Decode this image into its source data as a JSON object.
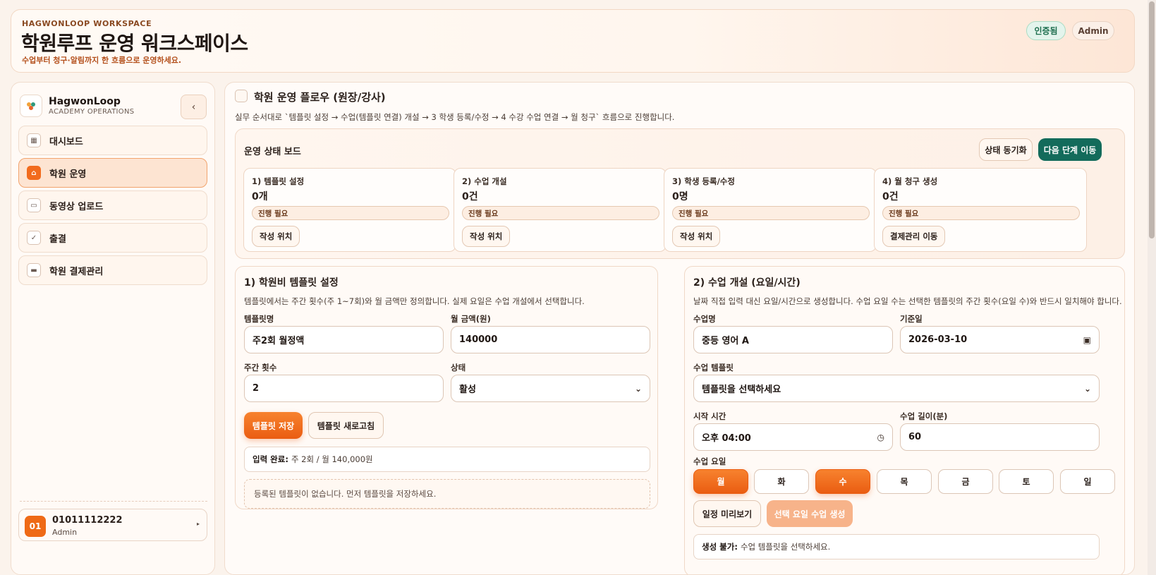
{
  "header": {
    "eyebrow": "HAGWONLOOP WORKSPACE",
    "title": "학원루프 운영 워크스페이스",
    "subtitle": "수업부터 청구·알림까지 한 흐름으로 운영하세요.",
    "verified_label": "인증됨",
    "role_label": "Admin"
  },
  "sidebar": {
    "brand_name": "HagwonLoop",
    "brand_sub": "ACADEMY OPERATIONS",
    "collapse_icon": "‹",
    "items": [
      {
        "label": "대시보드",
        "icon": "dashboard-icon",
        "active": false
      },
      {
        "label": "학원 운영",
        "icon": "building-icon",
        "active": true
      },
      {
        "label": "동영상 업로드",
        "icon": "video-icon",
        "active": false
      },
      {
        "label": "출결",
        "icon": "calendar-check-icon",
        "active": false
      },
      {
        "label": "학원 결제관리",
        "icon": "card-icon",
        "active": false
      }
    ],
    "user": {
      "badge": "01",
      "phone": "01011112222",
      "role": "Admin",
      "caret": "▸"
    }
  },
  "flow": {
    "title": "학원 운영 플로우 (원장/강사)",
    "description": "실무 순서대로 `템플릿 설정 → 수업(템플릿 연결) 개설 → 3 학생 등록/수정 → 4 수강 수업 연결 → 월 청구` 흐름으로 진행합니다."
  },
  "board": {
    "title": "운영 상태 보드",
    "sync_label": "상태 동기화",
    "next_label": "다음 단계 이동",
    "steps": [
      {
        "title": "1) 템플릿 설정",
        "value": "0개",
        "status": "진행 필요",
        "action": "작성 위치"
      },
      {
        "title": "2) 수업 개설",
        "value": "0건",
        "status": "진행 필요",
        "action": "작성 위치"
      },
      {
        "title": "3) 학생 등록/수정",
        "value": "0명",
        "status": "진행 필요",
        "action": "작성 위치"
      },
      {
        "title": "4) 월 청구 생성",
        "value": "0건",
        "status": "진행 필요",
        "action": "결제관리 이동"
      }
    ]
  },
  "template_panel": {
    "title": "1) 학원비 템플릿 설정",
    "description": "템플릿에서는 주간 횟수(주 1~7회)와 월 금액만 정의합니다. 실제 요일은 수업 개설에서 선택합니다.",
    "name_label": "템플릿명",
    "name_value": "주2회 월정액",
    "amount_label": "월 금액(원)",
    "amount_value": "140000",
    "weekly_label": "주간 횟수",
    "weekly_value": "2",
    "status_label": "상태",
    "status_value": "활성",
    "save_label": "템플릿 저장",
    "refresh_label": "템플릿 새로고침",
    "summary_prefix": "입력 완료:",
    "summary_text": "주 2회 / 월 140,000원",
    "empty_text": "등록된 템플릿이 없습니다. 먼저 템플릿을 저장하세요."
  },
  "class_panel": {
    "title": "2) 수업 개설 (요일/시간)",
    "description": "날짜 직접 입력 대신 요일/시간으로 생성합니다. 수업 요일 수는 선택한 템플릿의 주간 횟수(요일 수)와 반드시 일치해야 합니다.",
    "class_name_label": "수업명",
    "class_name_value": "중등 영어 A",
    "base_date_label": "기준일",
    "base_date_value": "2026-03-10",
    "template_label": "수업 템플릿",
    "template_value": "템플릿을 선택하세요",
    "start_label": "시작 시간",
    "start_value": "오후 04:00",
    "length_label": "수업 길이(분)",
    "length_value": "60",
    "days_label": "수업 요일",
    "days": [
      {
        "label": "월",
        "selected": true
      },
      {
        "label": "화",
        "selected": false
      },
      {
        "label": "수",
        "selected": true
      },
      {
        "label": "목",
        "selected": false
      },
      {
        "label": "금",
        "selected": false
      },
      {
        "label": "토",
        "selected": false
      },
      {
        "label": "일",
        "selected": false
      }
    ],
    "preview_label": "일정 미리보기",
    "generate_label": "선택 요일 수업 생성",
    "error_prefix": "생성 불가:",
    "error_text": "수업 템플릿을 선택하세요."
  },
  "colors": {
    "accent": "#ea5d12",
    "teal": "#136b5b",
    "verified_bg": "#e3f4ec"
  }
}
